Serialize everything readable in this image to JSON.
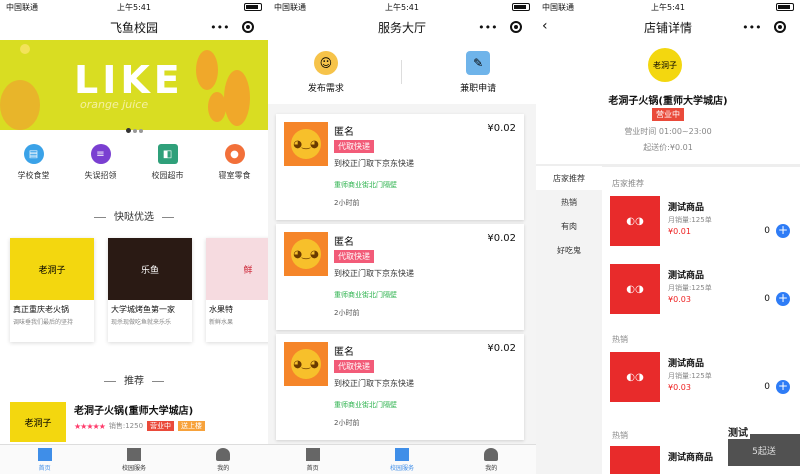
{
  "status": {
    "carrier": "中国联通",
    "time": "上午5:41"
  },
  "screen1": {
    "title": "飞鱼校园",
    "banner": {
      "word": "LIKE",
      "sub": "orange juice"
    },
    "categories": [
      {
        "label": "学校食堂",
        "color": "#3aa2e8",
        "icon": "canteen-icon"
      },
      {
        "label": "失误招领",
        "color": "#7a3fd1",
        "icon": "lost-found-icon"
      },
      {
        "label": "校园超市",
        "color": "#2fa07a",
        "icon": "cart-icon"
      },
      {
        "label": "寝室零食",
        "color": "#f2703a",
        "icon": "snack-icon"
      }
    ],
    "section_quick": "快哒优选",
    "products": [
      {
        "title": "真正重庆老火锅",
        "desc": "调味垂我们最后的坚持",
        "bg": "#f3d70f",
        "logo": "老洞子"
      },
      {
        "title": "大学城烤鱼第一家",
        "desc": "现杀现做吃鱼就来乐乐",
        "bg": "#2a1a14",
        "logo": "乐鱼"
      },
      {
        "title": "水果特",
        "desc": "新鲜水果",
        "bg": "#f6dbe0",
        "logo": "鲜"
      }
    ],
    "section_rec": "推荐",
    "rec": {
      "name": "老洞子火锅(重师大学城店)",
      "stars": "★★★★★",
      "sales": "销售:1250",
      "open": "营业中",
      "send": "送上楼",
      "logo": "老洞子"
    },
    "tabs": [
      "首页",
      "校园服务",
      "我的"
    ]
  },
  "screen2": {
    "title": "服务大厅",
    "actions": [
      {
        "label": "发布需求",
        "icon": "publish-icon"
      },
      {
        "label": "兼职申请",
        "icon": "parttime-icon"
      }
    ],
    "cards": [
      {
        "name": "匿名",
        "price": "¥0.02",
        "tag": "代取快递",
        "desc": "到校正门取下京东快递",
        "addr": "重师商业街北门隔壁",
        "time": "2小时前"
      },
      {
        "name": "匿名",
        "price": "¥0.02",
        "tag": "代取快递",
        "desc": "到校正门取下京东快递",
        "addr": "重师商业街北门隔壁",
        "time": "2小时前"
      },
      {
        "name": "匿名",
        "price": "¥0.02",
        "tag": "代取快递",
        "desc": "到校正门取下京东快递",
        "addr": "重师商业街北门隔壁",
        "time": "2小时前"
      }
    ],
    "tabs": [
      "首页",
      "校园服务",
      "我的"
    ]
  },
  "screen3": {
    "title": "店铺详情",
    "logo": "老洞子",
    "name": "老洞子火锅(重师大学城店)",
    "status": "营业中",
    "hours": "营业时间 01:00~23:00",
    "min": "起送价:¥0.01",
    "sidebar": [
      "店家推荐",
      "热销",
      "有肉",
      "好吃鬼"
    ],
    "groups": [
      "店家推荐",
      "热销",
      "热销"
    ],
    "items": [
      {
        "name": "测试商品",
        "sales": "月销量:125单",
        "price": "¥0.01",
        "qty": "0"
      },
      {
        "name": "测试商品",
        "sales": "月销量:125单",
        "price": "¥0.03",
        "qty": "0"
      },
      {
        "name": "测试商品",
        "sales": "月销量:125单",
        "price": "¥0.03",
        "qty": "0"
      },
      {
        "name": "测试商商品",
        "sales": "",
        "price": "",
        "qty": ""
      }
    ],
    "toast_title": "测试",
    "toast_text": "5起送"
  }
}
